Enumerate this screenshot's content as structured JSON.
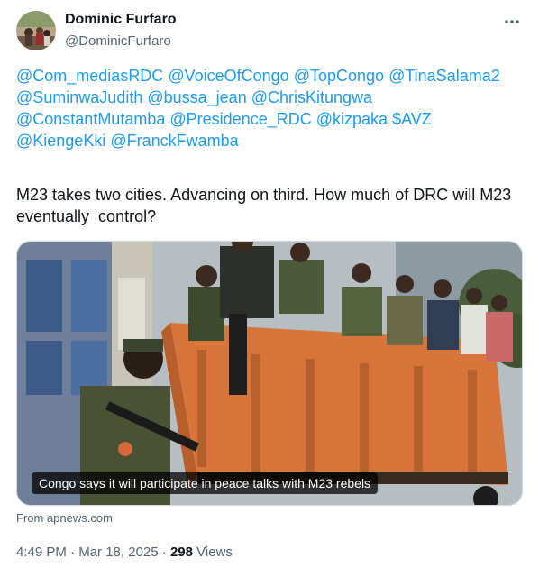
{
  "author": {
    "name": "Dominic Furfaro",
    "handle": "@DominicFurfaro"
  },
  "mentions": [
    "@Com_mediasRDC",
    "@VoiceOfCongo",
    "@TopCongo",
    "@TinaSalama2",
    "@SuminwaJudith",
    "@bussa_jean",
    "@ChrisKitungwa",
    "@ConstantMutamba",
    "@Presidence_RDC",
    "@kizpaka",
    "$AVZ",
    "@KiengeKki",
    "@FranckFwamba"
  ],
  "body_text": "M23 takes two cities. Advancing on third. How much of DRC will M23 eventually  control?",
  "link_card": {
    "caption": "Congo says it will participate in peace talks with M23 rebels",
    "source": "From apnews.com"
  },
  "meta": {
    "time": "4:49 PM",
    "separator": "·",
    "date": "Mar 18, 2025",
    "views_count": "298",
    "views_label": "Views"
  },
  "icons": {
    "more": "more-horizontal-icon"
  }
}
